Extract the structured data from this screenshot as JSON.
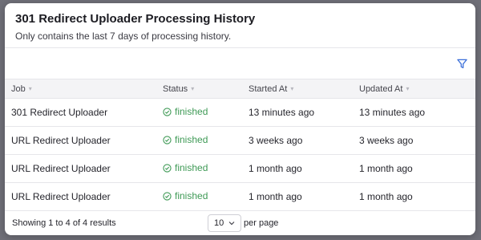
{
  "modal": {
    "title": "301 Redirect Uploader Processing History",
    "subtitle": "Only contains the last 7 days of processing history."
  },
  "table": {
    "columns": [
      "Job",
      "Status",
      "Started At",
      "Updated At"
    ],
    "rows": [
      {
        "job": "301 Redirect Uploader",
        "status": "finished",
        "started_at": "13 minutes ago",
        "updated_at": "13 minutes ago"
      },
      {
        "job": "URL Redirect Uploader",
        "status": "finished",
        "started_at": "3 weeks ago",
        "updated_at": "3 weeks ago"
      },
      {
        "job": "URL Redirect Uploader",
        "status": "finished",
        "started_at": "1 month ago",
        "updated_at": "1 month ago"
      },
      {
        "job": "URL Redirect Uploader",
        "status": "finished",
        "started_at": "1 month ago",
        "updated_at": "1 month ago"
      }
    ]
  },
  "footer": {
    "summary": "Showing 1 to 4 of 4 results",
    "per_page_value": "10",
    "per_page_label": "per page"
  },
  "colors": {
    "accent": "#3b6fd9",
    "status_finished": "#3f9a56"
  },
  "icons": {
    "filter": "filter-icon",
    "status": "check-circle-icon",
    "sort": "sort-arrow-icon",
    "select": "chevron-down-icon"
  }
}
